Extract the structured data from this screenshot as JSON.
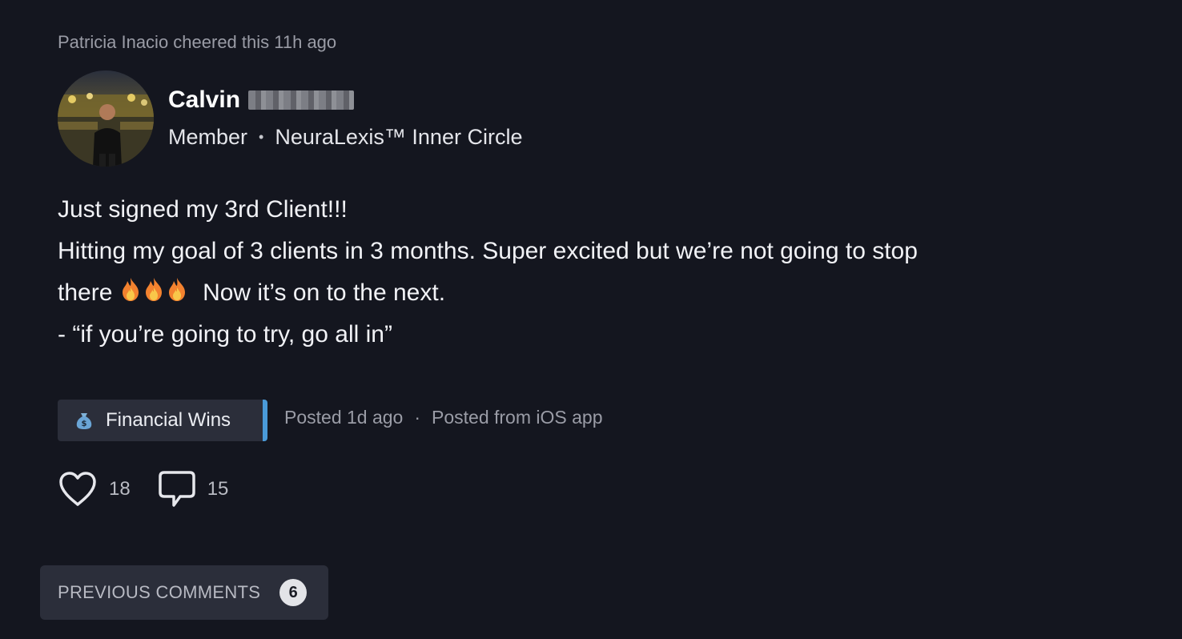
{
  "activity": {
    "cheer_text": "Patricia Inacio cheered this 11h ago"
  },
  "author": {
    "first_name": "Calvin",
    "role": "Member",
    "separator": "•",
    "group": "NeuraLexis™ Inner Circle"
  },
  "post": {
    "line1": "Just signed my 3rd Client!!!",
    "line2": "Hitting my goal of 3 clients in 3 months. Super excited but we’re not going to stop",
    "line3_start": "there",
    "line3_end": "Now it’s on to the next.",
    "line4": "- “if you’re going to try, go all in”",
    "emoji_icons": [
      "fire-icon",
      "fire-icon",
      "fire-icon"
    ]
  },
  "category": {
    "icon": "money-bag-icon",
    "label": "Financial Wins",
    "accent_color": "#4a9ad8"
  },
  "post_info": {
    "posted": "Posted 1d ago",
    "separator": "·",
    "source": "Posted from iOS app"
  },
  "actions": {
    "likes": "18",
    "comments": "15"
  },
  "previous_comments": {
    "label": "PREVIOUS COMMENTS",
    "count": "6"
  },
  "colors": {
    "background": "#14161f",
    "tag_background": "#2b2e3a",
    "muted_text": "#9a9ca6"
  }
}
